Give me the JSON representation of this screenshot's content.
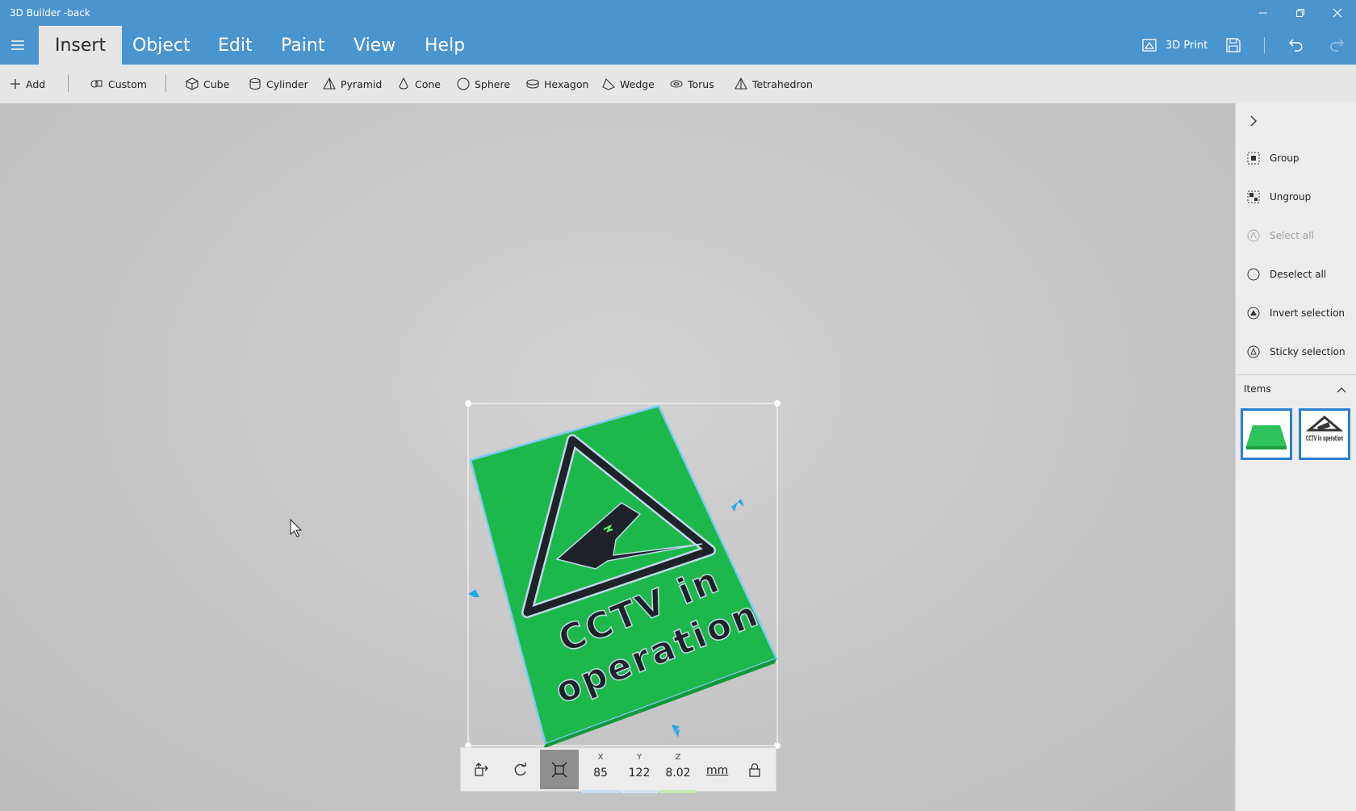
{
  "window": {
    "title": "3D Builder -back"
  },
  "menu": {
    "tabs": [
      {
        "label": "Insert"
      },
      {
        "label": "Object"
      },
      {
        "label": "Edit"
      },
      {
        "label": "Paint"
      },
      {
        "label": "View"
      },
      {
        "label": "Help"
      }
    ],
    "active_tab": "Insert",
    "print_label": "3D Print"
  },
  "toolbar": {
    "add": "Add",
    "custom": "Custom",
    "shapes": [
      "Cube",
      "Cylinder",
      "Pyramid",
      "Cone",
      "Sphere",
      "Hexagon",
      "Wedge",
      "Torus",
      "Tetrahedron"
    ]
  },
  "sidepanel": {
    "items": [
      {
        "label": "Group",
        "enabled": true,
        "icon": "group-icon"
      },
      {
        "label": "Ungroup",
        "enabled": true,
        "icon": "ungroup-icon"
      },
      {
        "label": "Select all",
        "enabled": false,
        "icon": "select-all-icon"
      },
      {
        "label": "Deselect all",
        "enabled": true,
        "icon": "deselect-all-icon"
      },
      {
        "label": "Invert selection",
        "enabled": true,
        "icon": "invert-selection-icon"
      },
      {
        "label": "Sticky selection",
        "enabled": true,
        "icon": "sticky-selection-icon"
      }
    ],
    "items_header": "Items",
    "thumbnail_labels": [
      "CCTV in operation"
    ]
  },
  "model": {
    "line1": "CCTV in",
    "line2": "operation"
  },
  "transform": {
    "x_label": "X",
    "x_value": "85",
    "y_label": "Y",
    "y_value": "122",
    "z_label": "Z",
    "z_value": "8.02",
    "unit": "mm"
  },
  "colors": {
    "accent": "#4a94cf",
    "sign_green": "#1db84b",
    "selection_blue": "#2a7fd0",
    "x_axis": "#c9dcee",
    "z_axis": "#c8e6b8"
  }
}
